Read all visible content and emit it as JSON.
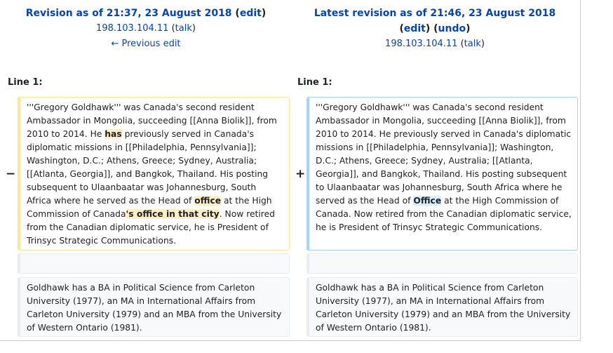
{
  "left": {
    "title_prefix": "Revision as of 21:37, 23 August 2018",
    "edit_label": "edit",
    "user": "198.103.104.11",
    "talk_label": "talk",
    "prev_edit": "← Previous edit",
    "line_label": "Line 1:",
    "marker": "−",
    "para1": {
      "t1": "'''Gregory Goldhawk''' was Canada's second resident Ambassador in Mongolia, succeeding [[Anna Biolik]], from 2010 to 2014. He ",
      "h1": "has",
      "t2": " previously served in Canada's diplomatic missions in [[Philadelphia, Pennsylvania]]; Washington, D.C.; Athens, Greece; Sydney, Australia; [[Atlanta, Georgia]], and Bangkok, Thailand. His posting subsequent to Ulaanbaatar was Johannesburg, South Africa where he served as the Head of ",
      "h2": "office",
      "t3": " at the High Commission of Canada",
      "h3": "'s office in that city",
      "t4": ".  Now retired from the Canadian diplomatic service, he is President of Trinsyc Strategic Communications."
    },
    "para2": "Goldhawk  has a BA in Political Science from Carleton University (1977), an MA in International Affairs from Carleton University (1979) and an MBA from the University of Western Ontario (1981)."
  },
  "right": {
    "title_prefix": "Latest revision as of 21:46, 23 August 2018",
    "edit_label": "edit",
    "undo_label": "undo",
    "user": "198.103.104.11",
    "talk_label": "talk",
    "line_label": "Line 1:",
    "marker": "+",
    "para1": {
      "t1": "'''Gregory Goldhawk''' was Canada's second resident Ambassador in Mongolia, succeeding [[Anna Biolik]], from 2010 to 2014. He previously served in Canada's diplomatic missions in [[Philadelphia, Pennsylvania]]; Washington, D.C.; Athens, Greece; Sydney, Australia; [[Atlanta, Georgia]], and Bangkok, Thailand. His posting subsequent to Ulaanbaatar was Johannesburg, South Africa where he served as the Head of ",
      "h1": "Office",
      "t2": " at the High Commission of Canada.  Now retired from the Canadian diplomatic service, he is President of Trinsyc Strategic Communications."
    },
    "para2": "Goldhawk  has a BA in Political Science from Carleton University (1977), an MA in International Affairs from Carleton University (1979) and an MBA from the University of Western Ontario (1981)."
  }
}
